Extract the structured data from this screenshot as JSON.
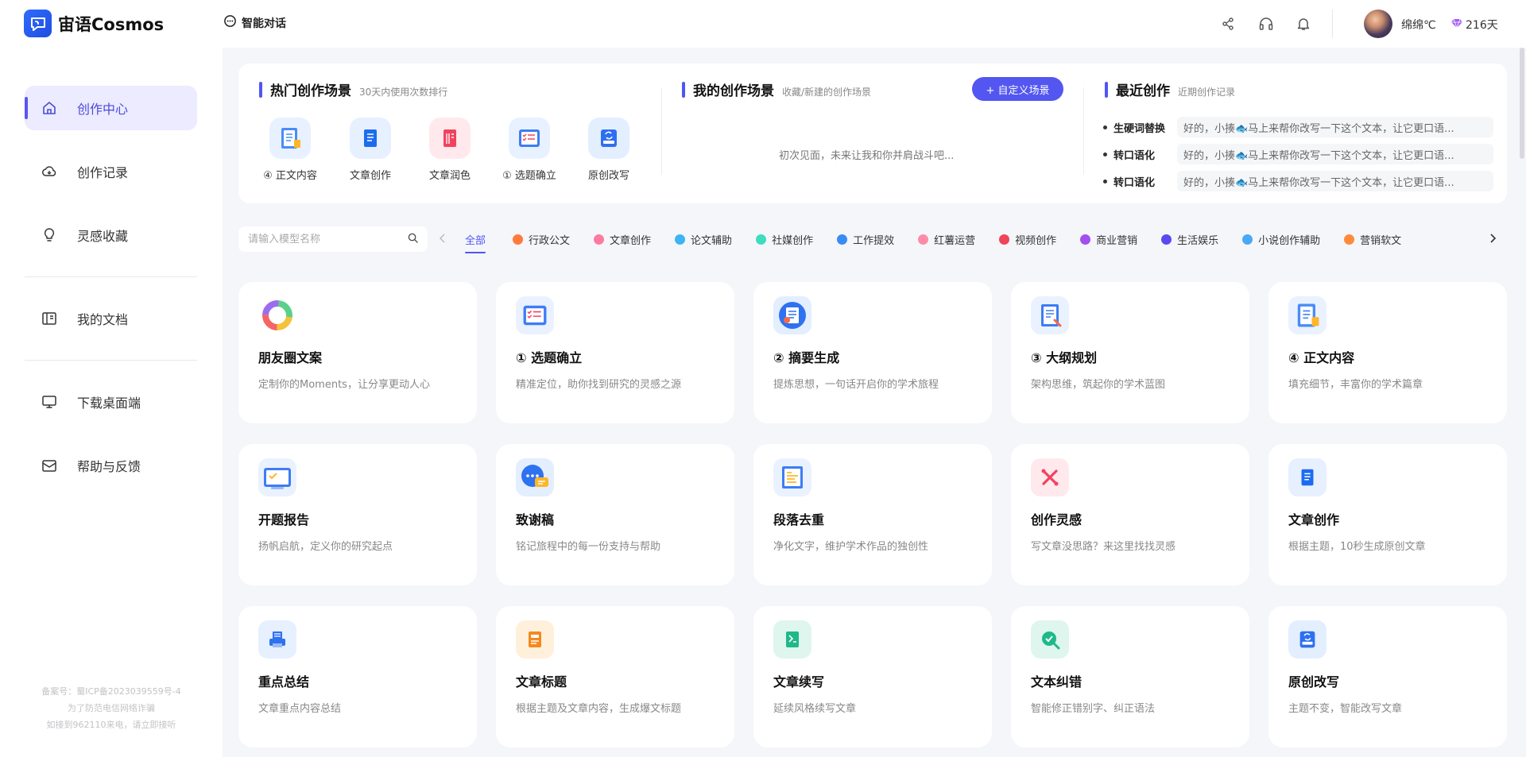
{
  "app": {
    "name": "宙语Cosmos",
    "chat_label": "智能对话"
  },
  "header": {
    "username": "绵绵℃",
    "vip_days": "216天"
  },
  "sidebar": {
    "items": [
      {
        "label": "创作中心",
        "icon": "home-icon"
      },
      {
        "label": "创作记录",
        "icon": "cloud-icon"
      },
      {
        "label": "灵感收藏",
        "icon": "bulb-icon"
      },
      {
        "label": "我的文档",
        "icon": "book-icon"
      },
      {
        "label": "下载桌面端",
        "icon": "monitor-icon"
      },
      {
        "label": "帮助与反馈",
        "icon": "mail-icon"
      }
    ],
    "icp": [
      "备案号：蜀ICP备2023039559号-4",
      "为了防范电信网络诈骗",
      "如接到962110来电，请立即接听"
    ]
  },
  "hot": {
    "title": "热门创作场景",
    "subtitle": "30天内使用次数排行",
    "items": [
      {
        "label": "④ 正文内容",
        "icon": "clipboard-icon",
        "color": "#e8f1ff"
      },
      {
        "label": "文章创作",
        "icon": "notebook-icon",
        "color": "#e6f0ff"
      },
      {
        "label": "文章润色",
        "icon": "red-book-icon",
        "color": "#ffe9ec"
      },
      {
        "label": "① 选题确立",
        "icon": "checklist-icon",
        "color": "#e8f1ff"
      },
      {
        "label": "原创改写",
        "icon": "rewrite-icon",
        "color": "#e3efff"
      }
    ]
  },
  "mine": {
    "title": "我的创作场景",
    "subtitle": "收藏/新建的创作场景",
    "button": "+ 自定义场景",
    "empty": "初次见面，未来让我和你并肩战斗吧..."
  },
  "recent": {
    "title": "最近创作",
    "subtitle": "近期创作记录",
    "items": [
      {
        "name": "生硬词替换",
        "text": "好的，小揍🐟马上来帮你改写一下这个文本，让它更口语..."
      },
      {
        "name": "转口语化",
        "text": "好的，小揍🐟马上来帮你改写一下这个文本，让它更口语..."
      },
      {
        "name": "转口语化",
        "text": "好的，小揍🐟马上来帮你改写一下这个文本，让它更口语..."
      }
    ]
  },
  "search": {
    "placeholder": "请输入模型名称"
  },
  "categories": [
    {
      "label": "全部",
      "color": ""
    },
    {
      "label": "行政公文",
      "color": "#ff7a3c"
    },
    {
      "label": "文章创作",
      "color": "#ff7aa0"
    },
    {
      "label": "论文辅助",
      "color": "#3cb4f5"
    },
    {
      "label": "社媒创作",
      "color": "#3fdcc0"
    },
    {
      "label": "工作提效",
      "color": "#3a8cf5"
    },
    {
      "label": "红薯运营",
      "color": "#ff8ca6"
    },
    {
      "label": "视频创作",
      "color": "#f04458"
    },
    {
      "label": "商业营销",
      "color": "#a34ff0"
    },
    {
      "label": "生活娱乐",
      "color": "#5a49f0"
    },
    {
      "label": "小说创作辅助",
      "color": "#4aa8f5"
    },
    {
      "label": "营销软文",
      "color": "#ff8a3c"
    }
  ],
  "cards": [
    {
      "title": "朋友圈文案",
      "desc": "定制你的Moments，让分享更动人心",
      "icon": "ring-icon",
      "color": "#ffffff"
    },
    {
      "title": "① 选题确立",
      "desc": "精准定位，助你找到研究的灵感之源",
      "icon": "checklist-icon",
      "color": "#eaf2ff"
    },
    {
      "title": "② 摘要生成",
      "desc": "提炼思想，一句话开启你的学术旅程",
      "icon": "summary-icon",
      "color": "#e3eeff"
    },
    {
      "title": "③ 大纲规划",
      "desc": "架构思维，筑起你的学术蓝图",
      "icon": "outline-icon",
      "color": "#eaf2ff"
    },
    {
      "title": "④ 正文内容",
      "desc": "填充细节，丰富你的学术篇章",
      "icon": "clipboard-icon",
      "color": "#eaf2ff"
    },
    {
      "title": "开题报告",
      "desc": "扬帆启航，定义你的研究起点",
      "icon": "report-icon",
      "color": "#eaf2ff"
    },
    {
      "title": "致谢稿",
      "desc": "铭记旅程中的每一份支持与帮助",
      "icon": "chat-bubble-icon",
      "color": "#e3eeff"
    },
    {
      "title": "段落去重",
      "desc": "净化文字，维护学术作品的独创性",
      "icon": "paragraph-icon",
      "color": "#eaf2ff"
    },
    {
      "title": "创作灵感",
      "desc": "写文章没思路？来这里找找灵感",
      "icon": "inspiration-icon",
      "color": "#ffe9ec"
    },
    {
      "title": "文章创作",
      "desc": "根据主题，10秒生成原创文章",
      "icon": "notebook-icon",
      "color": "#e6f0ff"
    },
    {
      "title": "重点总结",
      "desc": "文章重点内容总结",
      "icon": "printer-icon",
      "color": "#e6f0ff"
    },
    {
      "title": "文章标题",
      "desc": "根据主题及文章内容，生成爆文标题",
      "icon": "headline-icon",
      "color": "#fff0dc"
    },
    {
      "title": "文章续写",
      "desc": "延续风格续写文章",
      "icon": "continue-icon",
      "color": "#def6ee"
    },
    {
      "title": "文本纠错",
      "desc": "智能修正错别字、纠正语法",
      "icon": "check-search-icon",
      "color": "#def6ee"
    },
    {
      "title": "原创改写",
      "desc": "主题不变，智能改写文章",
      "icon": "rewrite-icon",
      "color": "#e3efff"
    }
  ]
}
